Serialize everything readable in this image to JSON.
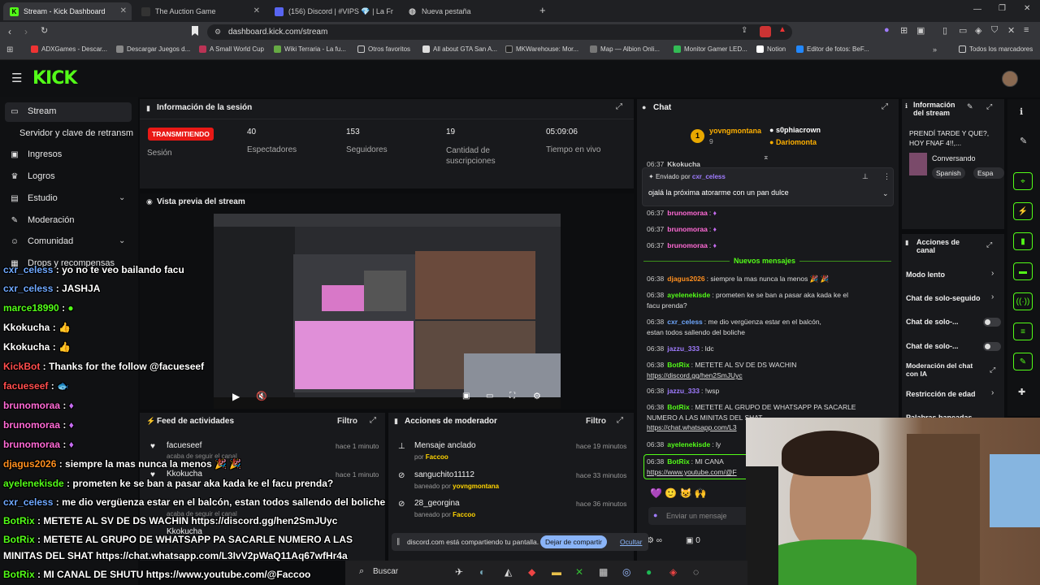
{
  "browser": {
    "tabs": [
      {
        "title": "Stream - Kick Dashboard",
        "active": true
      },
      {
        "title": "The Auction Game",
        "active": false
      },
      {
        "title": "(156) Discord | #VIPS 💎 | La Fr",
        "active": false
      },
      {
        "title": "Nueva pestaña",
        "active": false
      }
    ],
    "url": "dashboard.kick.com/stream",
    "bookmarks": [
      "ADXGames - Descar...",
      "Descargar Juegos d...",
      "A Small World Cup",
      "Wiki Terraria - La fu...",
      "Otros favoritos",
      "All about GTA San A...",
      "MKWarehouse: Mor...",
      "Map — Albion Onli...",
      "Monitor Gamer LED...",
      "Notion",
      "Editor de fotos: BeF...",
      "Todos los marcadores"
    ]
  },
  "app": {
    "logo": "KICK"
  },
  "sidebar": {
    "items": [
      {
        "label": "Stream",
        "icon": "video-icon"
      },
      {
        "label": "Servidor y clave de retransm",
        "icon": ""
      },
      {
        "label": "Ingresos",
        "icon": "money-icon"
      },
      {
        "label": "Logros",
        "icon": "trophy-icon"
      },
      {
        "label": "Estudio",
        "icon": "studio-icon"
      },
      {
        "label": "Moderación",
        "icon": "wrench-icon"
      },
      {
        "label": "Comunidad",
        "icon": "users-icon"
      },
      {
        "label": "Drops y recompensas",
        "icon": "gift-icon"
      }
    ]
  },
  "session": {
    "title": "Información de la sesión",
    "badge": "TRANSMITIENDO",
    "badge_label": "Sesión",
    "stats": [
      {
        "value": "40",
        "label": "Espectadores"
      },
      {
        "value": "153",
        "label": "Seguidores"
      },
      {
        "value": "19",
        "label": "Cantidad de suscripciones"
      },
      {
        "value": "05:09:06",
        "label": "Tiempo en vivo"
      }
    ]
  },
  "preview": {
    "title": "Vista previa del stream"
  },
  "activity": {
    "title": "Feed de actividades",
    "filter": "Filtro",
    "items": [
      {
        "user": "facueseef",
        "sub": "acaba de seguir el canal",
        "time": "hace 1 minuto"
      },
      {
        "user": "Kkokucha",
        "sub": "acaba de seguir el canal",
        "time": "hace 1 minuto"
      },
      {
        "user": "Kkokucha",
        "sub": "",
        "time": "hace 1 minuto"
      }
    ]
  },
  "modactions": {
    "title": "Acciones de moderador",
    "filter": "Filtro",
    "items": [
      {
        "action": "Mensaje anclado",
        "by_prefix": "por",
        "by": "Faccoo",
        "time": "hace 19 minutos"
      },
      {
        "action": "sanguchito11112",
        "by_prefix": "baneado por",
        "by": "yovngmontana",
        "time": "hace 33 minutos"
      },
      {
        "action": "28_georgina",
        "by_prefix": "baneado por",
        "by": "Faccoo",
        "time": "hace 36 minutos"
      }
    ]
  },
  "chat": {
    "title": "Chat",
    "top_gifter": {
      "name": "yovngmontana",
      "count": "9"
    },
    "top_users": [
      "s0phiacrown",
      "Dariomonta"
    ],
    "pinned_by_label": "Enviado por",
    "pinned_by": "cxr_celess",
    "pinned_text": "ojalá la próxima atorarme con un pan dulce",
    "new_messages": "Nuevos mensajes",
    "input_placeholder": "Enviar un mensaje",
    "viewer_count": "0",
    "messages": [
      {
        "time": "06:37",
        "user": "Kkokucha",
        "color": "#d0d0d0",
        "text": ""
      },
      {
        "time": "06:37",
        "user": "brunomoraa",
        "color": "#ff6ad5",
        "text": ""
      },
      {
        "time": "06:37",
        "user": "brunomoraa",
        "color": "#ff6ad5",
        "text": ""
      },
      {
        "time": "06:37",
        "user": "brunomoraa",
        "color": "#ff6ad5",
        "text": ""
      },
      {
        "time": "06:38",
        "user": "djagus2026",
        "color": "#ff8f1f",
        "text": "siempre la mas nunca la menos 🎉 🎉"
      },
      {
        "time": "06:38",
        "user": "ayelenekisde",
        "color": "#53fc18",
        "text": "prometen ke se ban a pasar aka kada ke el"
      },
      {
        "time": "",
        "user": "",
        "color": "",
        "text": "facu prenda?"
      },
      {
        "time": "06:38",
        "user": "cxr_celess",
        "color": "#6fa8ff",
        "text": "me dio vergüenza estar en el balcón,"
      },
      {
        "time": "",
        "user": "",
        "color": "",
        "text": "estan todos sallendo del boliche"
      },
      {
        "time": "06:38",
        "user": "jazzu_333",
        "color": "#a07cff",
        "text": "ldc"
      },
      {
        "time": "06:38",
        "user": "BotRix",
        "color": "#53fc18",
        "text": "METETE AL SV DE DS WACHIN"
      },
      {
        "time": "",
        "user": "",
        "color": "",
        "text": "https://discord.gg/hen2SmJUyc"
      },
      {
        "time": "06:38",
        "user": "jazzu_333",
        "color": "#a07cff",
        "text": "!wsp"
      },
      {
        "time": "06:38",
        "user": "BotRix",
        "color": "#53fc18",
        "text": "METETE AL GRUPO DE WHATSAPP PA SACARLE"
      },
      {
        "time": "",
        "user": "",
        "color": "",
        "text": "NUMERO A LAS MINITAS DEL SHAT"
      },
      {
        "time": "",
        "user": "",
        "color": "",
        "text": "https://chat.whatsapp.com/L3"
      },
      {
        "time": "06:38",
        "user": "ayelenekisde",
        "color": "#53fc18",
        "text": "ly"
      },
      {
        "time": "06:38",
        "user": "BotRix",
        "color": "#53fc18",
        "text": "MI CANA"
      },
      {
        "time": "",
        "user": "",
        "color": "",
        "text": "https://www.youtube.com/@F"
      }
    ]
  },
  "stream_info": {
    "title": "Información del stream",
    "stream_title": "PRENDÍ TARDE Y QUE?, HOY FNAF 4!!,...",
    "category": "Conversando",
    "tags": [
      "Spanish",
      "Espa"
    ]
  },
  "channel_actions": {
    "title": "Acciones de canal",
    "items": [
      "Modo lento",
      "Chat de solo-seguido",
      "Chat de solo-...",
      "Chat de solo-...",
      "Moderación del chat con IA",
      "Restricción de edad",
      "Palabras baneadas"
    ]
  },
  "overlay_chat": [
    {
      "user": "cxr_celess",
      "color": "#6fa8ff",
      "text": "yo no te veo bailando facu"
    },
    {
      "user": "cxr_celess",
      "color": "#6fa8ff",
      "text": "JASHJA"
    },
    {
      "user": "marce18990",
      "color": "#53fc18",
      "text": ""
    },
    {
      "user": "Kkokucha",
      "color": "#ffffff",
      "text": ""
    },
    {
      "user": "Kkokucha",
      "color": "#ffffff",
      "text": ""
    },
    {
      "user": "KickBot",
      "color": "#ff4d4d",
      "text": "Thanks for the follow @facueseef"
    },
    {
      "user": "facueseef",
      "color": "#ff4d4d",
      "text": ""
    },
    {
      "user": "brunomoraa",
      "color": "#ff6ad5",
      "text": ""
    },
    {
      "user": "brunomoraa",
      "color": "#ff6ad5",
      "text": ""
    },
    {
      "user": "brunomoraa",
      "color": "#ff6ad5",
      "text": ""
    },
    {
      "user": "djagus2026",
      "color": "#ff8f1f",
      "text": "siempre la mas nunca la menos 🎉 🎉"
    },
    {
      "user": "ayelenekisde",
      "color": "#53fc18",
      "text": "prometen ke se ban a pasar aka kada ke el facu prenda?"
    },
    {
      "user": "cxr_celess",
      "color": "#6fa8ff",
      "text": "me dio vergüenza estar en el balcón, estan todos sallendo del boliche"
    },
    {
      "user": "BotRix",
      "color": "#53fc18",
      "text": "METETE AL SV DE DS WACHIN https://discord.gg/hen2SmJUyc"
    },
    {
      "user": "BotRix",
      "color": "#53fc18",
      "text": "METETE AL GRUPO DE WHATSAPP PA SACARLE NUMERO A LAS"
    },
    {
      "user": "",
      "color": "",
      "text": "MINITAS DEL SHAT https://chat.whatsapp.com/L3IvV2pWaQ11Aq67wfHr4a"
    },
    {
      "user": "BotRix",
      "color": "#53fc18",
      "text": "MI CANAL DE SHUTU https://www.youtube.com/@Faccoo"
    }
  ],
  "share_bar": {
    "text": "discord.com está compartiendo tu pantalla.",
    "stop": "Dejar de compartir",
    "hide": "Ocultar"
  },
  "taskbar": {
    "search": "Buscar"
  },
  "colors": {
    "accent": "#53fc18",
    "panel": "#18191c",
    "live": "#e91916"
  }
}
